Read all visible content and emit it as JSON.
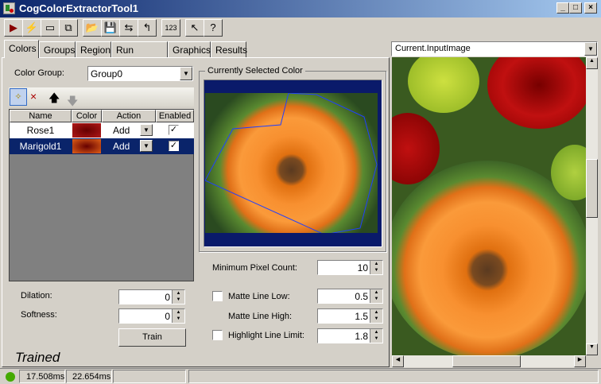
{
  "window": {
    "title": "CogColorExtractorTool1",
    "min": "_",
    "max": "□",
    "close": "×"
  },
  "toolbar": {
    "icons": [
      "run-icon",
      "lightning-icon",
      "window-icon",
      "window-lock-icon",
      "open-folder-icon",
      "save-icon",
      "save-as-icon",
      "reset-icon",
      "counter-123-icon",
      "pointer-ruler-icon",
      "help-icon"
    ],
    "glyphs": [
      "▶",
      "⚡",
      "▭",
      "⧉",
      "📂",
      "💾",
      "⇆",
      "↰",
      "123",
      "↖",
      "?"
    ]
  },
  "tabs": [
    "Colors",
    "Groups",
    "Region",
    "Run Params",
    "Graphics",
    "Results"
  ],
  "colors": {
    "group_label": "Color Group:",
    "group_value": "Group0",
    "grid_toolbar": [
      "✧",
      "×",
      "🡅",
      "🡅"
    ],
    "columns": [
      "Name",
      "Color",
      "Action",
      "Enabled"
    ],
    "rows": [
      {
        "name": "Rose1",
        "action": "Add",
        "enabled": "✓",
        "swatch": "#b01818"
      },
      {
        "name": "Marigold1",
        "action": "Add",
        "enabled": "✓",
        "swatch": "#e06018"
      }
    ],
    "dilation_label": "Dilation:",
    "dilation": "0",
    "softness_label": "Softness:",
    "softness": "0",
    "train": "Train",
    "status": "Trained"
  },
  "selected": {
    "title": "Currently Selected Color"
  },
  "params": {
    "min_pixel_label": "Minimum Pixel Count:",
    "min_pixel": "10",
    "matte_low_label": "Matte Line Low:",
    "matte_low": "0.5",
    "matte_low_checked": false,
    "matte_high_label": "Matte Line High:",
    "matte_high": "1.5",
    "highlight_label": "Highlight Line Limit:",
    "highlight": "1.8",
    "highlight_checked": false
  },
  "viewer": {
    "source": "Current.InputImage"
  },
  "statusbar": {
    "time1": "17.508ms",
    "time2": "22.654ms",
    "indicator": "#44aa00"
  }
}
